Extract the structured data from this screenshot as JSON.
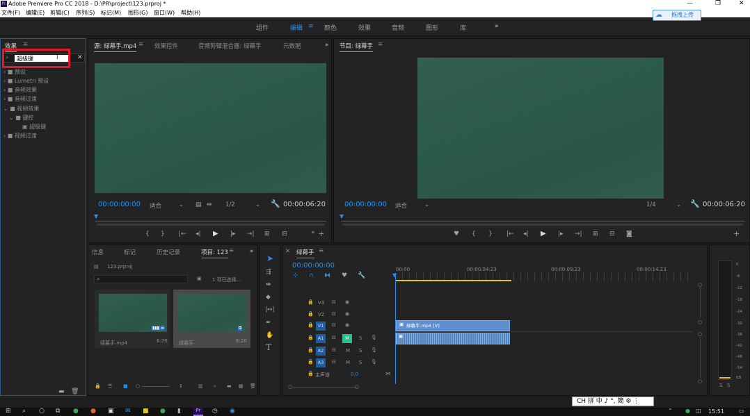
{
  "window": {
    "title": "Adobe Premiere Pro CC 2018 - D:\\PR\\project\\123.prproj *",
    "app_icon": "Pr"
  },
  "menu": [
    "文件(F)",
    "编辑(E)",
    "剪辑(C)",
    "序列(S)",
    "标记(M)",
    "图形(G)",
    "窗口(W)",
    "帮助(H)"
  ],
  "workspaces": {
    "items": [
      "组件",
      "编辑",
      "颜色",
      "效果",
      "音频",
      "图形",
      "库"
    ],
    "active": "编辑",
    "overflow": "»"
  },
  "upload_button": {
    "label": "拖拽上传"
  },
  "effects_panel": {
    "tab": "效果",
    "search_value": "超级键",
    "tree": [
      {
        "label": "预设",
        "level": 0
      },
      {
        "label": "Lumetri 预设",
        "level": 0
      },
      {
        "label": "音频效果",
        "level": 0
      },
      {
        "label": "音频过渡",
        "level": 0
      },
      {
        "label": "视频效果",
        "level": 0,
        "open": true
      },
      {
        "label": "键控",
        "level": 1,
        "open": true
      },
      {
        "label": "超级键",
        "level": 2
      },
      {
        "label": "视频过渡",
        "level": 0
      }
    ]
  },
  "source_monitor": {
    "tabs": [
      "源: 绿幕手.mp4",
      "效果控件",
      "音频剪辑混合器: 绿幕手",
      "元数据"
    ],
    "active_tab": "源: 绿幕手.mp4",
    "timecode": "00:00:00:00",
    "fit": "适合",
    "resolution": "1/2",
    "duration": "00:00:06:20",
    "controls": [
      "{",
      "}",
      "|←",
      "◂|",
      "▶",
      "|▸",
      "→|",
      "⊞",
      "⊟",
      "+"
    ]
  },
  "program_monitor": {
    "tab": "节目: 绿幕手",
    "timecode": "00:00:00:00",
    "fit": "适合",
    "resolution": "1/4",
    "duration": "00:00:06:20",
    "controls": [
      "♥",
      "{",
      "}",
      "|←",
      "◂|",
      "▶",
      "|▸",
      "→|",
      "⊞",
      "⊟",
      "◙",
      "+"
    ]
  },
  "project_panel": {
    "tabs": [
      "信息",
      "标记",
      "历史记录",
      "项目: 123"
    ],
    "active_tab": "项目: 123",
    "project_file": "123.prproj",
    "selection_info": "1 项已选择...",
    "items": [
      {
        "name": "绿幕手.mp4",
        "duration": "6:20",
        "selected": false
      },
      {
        "name": "绿幕手",
        "duration": "6:20",
        "selected": true
      }
    ]
  },
  "timeline": {
    "tab": "绿幕手",
    "timecode": "00:00:00:00",
    "ruler": [
      "00:00",
      "00:00:04:23",
      "00:00:09:23",
      "00:00:14:23"
    ],
    "tracks": [
      {
        "name": "V3",
        "type": "video"
      },
      {
        "name": "V2",
        "type": "video"
      },
      {
        "name": "V1",
        "type": "video",
        "clip": "绿幕手.mp4 [V]"
      },
      {
        "name": "A1",
        "type": "audio",
        "clip": true
      },
      {
        "name": "A2",
        "type": "audio"
      },
      {
        "name": "A3",
        "type": "audio"
      }
    ],
    "master": {
      "label": "主声道",
      "value": "0.0"
    },
    "track_buttons": {
      "mute": "M",
      "solo": "S"
    }
  },
  "audio_meter": {
    "scale": [
      "0",
      "-6",
      "-12",
      "-18",
      "-24",
      "-30",
      "-36",
      "-42",
      "-48",
      "-54",
      "dB"
    ],
    "buttons": [
      "S",
      "S"
    ]
  },
  "ime": {
    "text": "CH 拼 中 ♪ °, 简 ⚙ ⋮"
  },
  "clock": "15:51",
  "colors": {
    "accent": "#2d8ceb",
    "highlight_box": "#e0192a",
    "clip_video": "#5e8fd0",
    "clip_audio": "#4f84c4",
    "mute_on": "#27c08e"
  }
}
